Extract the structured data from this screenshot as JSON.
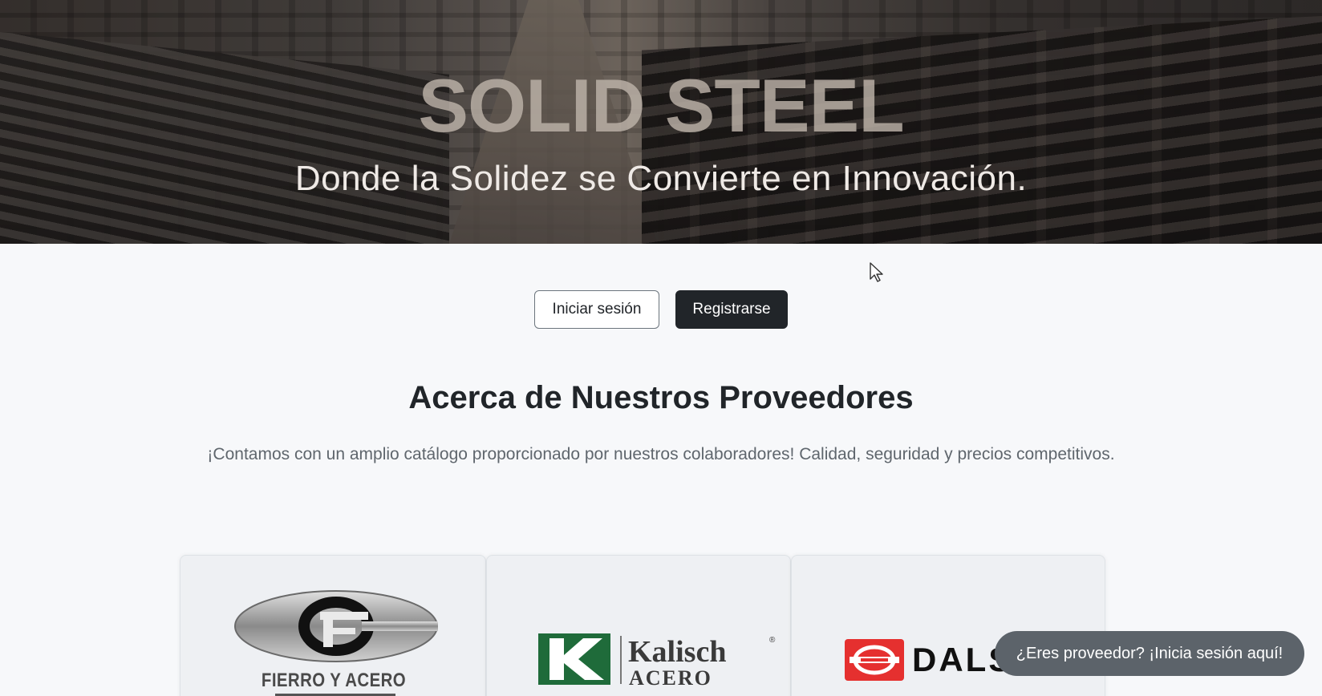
{
  "hero": {
    "title": "SOLID STEEL",
    "subtitle": "Donde la Solidez se Convierte en Innovación."
  },
  "auth": {
    "login_label": "Iniciar sesión",
    "register_label": "Registrarse"
  },
  "providers": {
    "heading": "Acerca de Nuestros Proveedores",
    "description": "¡Contamos con un amplio catálogo proporcionado por nuestros colaboradores! Calidad, seguridad y precios competitivos.",
    "logos": [
      {
        "name": "FIERRO Y ACERO",
        "icon": "fierro-y-acero-logo"
      },
      {
        "name": "Kalisch",
        "sub": "ACERO",
        "mark": "K",
        "reg": "®",
        "icon": "kalisch-logo"
      },
      {
        "name": "DALS",
        "icon": "dals-logo",
        "color": "#e5302f"
      }
    ]
  },
  "provider_cta": {
    "label": "¿Eres proveedor? ¡Inicia sesión aquí!"
  },
  "colors": {
    "dark_button": "#212529",
    "cta_pill": "#5c636a",
    "kalisch_green": "#1f6b3a",
    "dals_red": "#e5302f"
  }
}
